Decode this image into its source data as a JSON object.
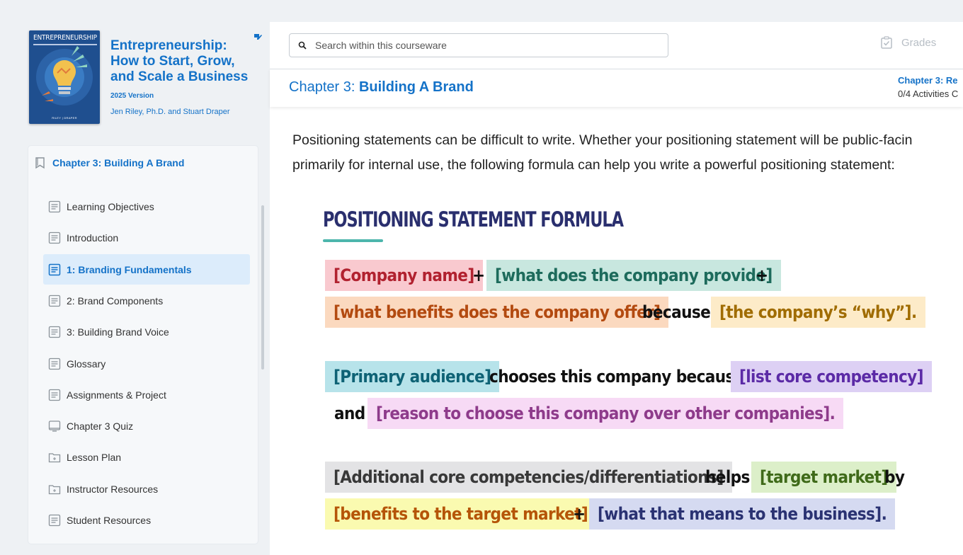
{
  "book": {
    "cover_title": "ENTREPRENEURSHIP",
    "cover_footer": "RILEY | DRAPER",
    "title": "Entrepreneurship: How to Start, Grow, and Scale a Business",
    "version": "2025 Version",
    "authors": "Jen Riley, Ph.D. and Stuart Draper"
  },
  "toc": {
    "header": "Chapter 3: Building A Brand",
    "items": [
      {
        "label": "Learning Objectives",
        "icon": "page-icon"
      },
      {
        "label": "Introduction",
        "icon": "page-icon"
      },
      {
        "label": "1: Branding Fundamentals",
        "icon": "page-icon",
        "active": true
      },
      {
        "label": "2: Brand Components",
        "icon": "page-icon"
      },
      {
        "label": "3: Building Brand Voice",
        "icon": "page-icon"
      },
      {
        "label": "Glossary",
        "icon": "page-icon"
      },
      {
        "label": "Assignments & Project",
        "icon": "page-icon"
      },
      {
        "label": "Chapter 3 Quiz",
        "icon": "quiz-icon"
      },
      {
        "label": "Lesson Plan",
        "icon": "folder-icon"
      },
      {
        "label": "Instructor Resources",
        "icon": "folder-icon"
      },
      {
        "label": "Student Resources",
        "icon": "page-icon"
      }
    ]
  },
  "search": {
    "placeholder": "Search within this courseware"
  },
  "grades_label": "Grades",
  "chapter": {
    "prefix": "Chapter 3: ",
    "name": "Building A Brand",
    "right_title": "Chapter 3: Re",
    "right_activities": "0/4 Activities C"
  },
  "content": {
    "paragraph_line1": "Positioning statements can be difficult to write. Whether your positioning statement will be public-facin",
    "paragraph_line2": "primarily for internal use, the following formula can help you write a powerful positioning statement:",
    "formula_title": "POSITIONING STATEMENT FORMULA",
    "f1": {
      "company_name": "[Company name]",
      "plus1": "+",
      "provides": "[what does the company provide]",
      "plus2": "+",
      "benefits": "[what benefits does the company offer]",
      "because": "because",
      "why": "[the company’s “why”]."
    },
    "f2": {
      "audience": "[Primary audience]",
      "chooses": "chooses this company because",
      "competency": "[list core competency]",
      "and": "and",
      "reason": "[reason to choose this company over other companies]."
    },
    "f3": {
      "additional": "[Additional core competencies/differentiations]",
      "helps": "helps",
      "market": "[target market]",
      "by": "by",
      "benefits_market": "[benefits to the target market]",
      "plus": "+",
      "means": "[what that means to the business]."
    }
  }
}
